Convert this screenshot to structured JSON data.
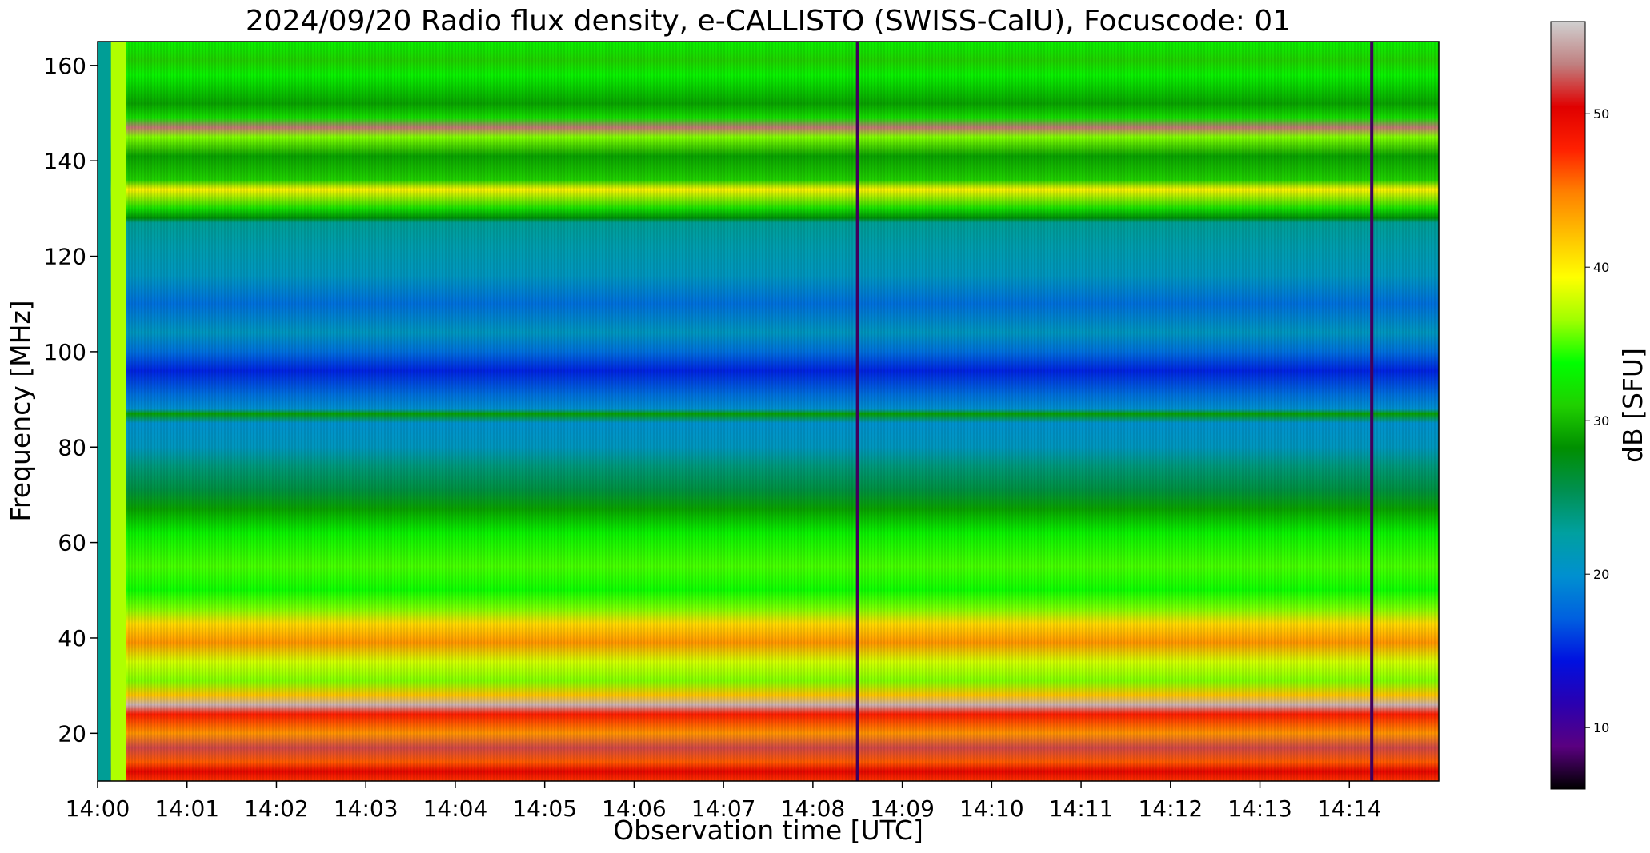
{
  "chart_data": {
    "type": "heatmap",
    "title": "2024/09/20  Radio flux density, e-CALLISTO (SWISS-CalU), Focuscode: 01",
    "xlabel": "Observation time [UTC]",
    "ylabel": "Frequency [MHz]",
    "colorbar_label": "dB [SFU]",
    "x_ticks": [
      "14:00",
      "14:01",
      "14:02",
      "14:03",
      "14:04",
      "14:05",
      "14:06",
      "14:07",
      "14:08",
      "14:09",
      "14:10",
      "14:11",
      "14:12",
      "14:13",
      "14:14"
    ],
    "x_range_minutes": [
      0,
      15
    ],
    "y_ticks": [
      20,
      40,
      60,
      80,
      100,
      120,
      140,
      160
    ],
    "y_range": [
      10,
      165
    ],
    "colorbar_ticks": [
      10,
      20,
      30,
      40,
      50
    ],
    "colorbar_range": [
      6,
      56
    ],
    "colormap": [
      "#000000",
      "#5a0080",
      "#2a00b0",
      "#0010e0",
      "#0060e0",
      "#0090d0",
      "#00a0a0",
      "#009050",
      "#008f00",
      "#20d000",
      "#00ff00",
      "#a0ff00",
      "#ffff00",
      "#ffc000",
      "#ff8000",
      "#ff2000",
      "#e00000",
      "#c08080",
      "#d0d0d0"
    ],
    "frequency_profile_db": [
      {
        "freq": 165,
        "db": 33
      },
      {
        "freq": 161,
        "db": 31
      },
      {
        "freq": 158,
        "db": 33
      },
      {
        "freq": 152,
        "db": 29
      },
      {
        "freq": 149,
        "db": 32
      },
      {
        "freq": 147,
        "db": 53
      },
      {
        "freq": 145,
        "db": 36
      },
      {
        "freq": 141,
        "db": 29
      },
      {
        "freq": 136,
        "db": 31
      },
      {
        "freq": 134,
        "db": 40
      },
      {
        "freq": 130,
        "db": 32
      },
      {
        "freq": 128,
        "db": 28
      },
      {
        "freq": 127,
        "db": 23
      },
      {
        "freq": 122,
        "db": 22
      },
      {
        "freq": 116,
        "db": 21
      },
      {
        "freq": 110,
        "db": 18
      },
      {
        "freq": 104,
        "db": 21
      },
      {
        "freq": 100,
        "db": 18
      },
      {
        "freq": 96,
        "db": 15
      },
      {
        "freq": 91,
        "db": 18
      },
      {
        "freq": 88,
        "db": 20
      },
      {
        "freq": 87,
        "db": 29
      },
      {
        "freq": 85,
        "db": 20
      },
      {
        "freq": 80,
        "db": 21
      },
      {
        "freq": 76,
        "db": 24
      },
      {
        "freq": 71,
        "db": 26
      },
      {
        "freq": 67,
        "db": 29
      },
      {
        "freq": 62,
        "db": 33
      },
      {
        "freq": 55,
        "db": 35
      },
      {
        "freq": 50,
        "db": 34
      },
      {
        "freq": 46,
        "db": 36
      },
      {
        "freq": 43,
        "db": 41
      },
      {
        "freq": 39,
        "db": 44
      },
      {
        "freq": 35,
        "db": 38
      },
      {
        "freq": 31,
        "db": 36
      },
      {
        "freq": 28,
        "db": 42
      },
      {
        "freq": 26,
        "db": 55
      },
      {
        "freq": 24,
        "db": 48
      },
      {
        "freq": 20,
        "db": 44
      },
      {
        "freq": 17,
        "db": 52
      },
      {
        "freq": 14,
        "db": 46
      },
      {
        "freq": 12,
        "db": 50
      },
      {
        "freq": 10,
        "db": 47
      }
    ],
    "events": [
      {
        "time": "14:08:30",
        "kind": "vertical spike"
      },
      {
        "time": "14:14:15",
        "kind": "vertical spike"
      }
    ]
  }
}
